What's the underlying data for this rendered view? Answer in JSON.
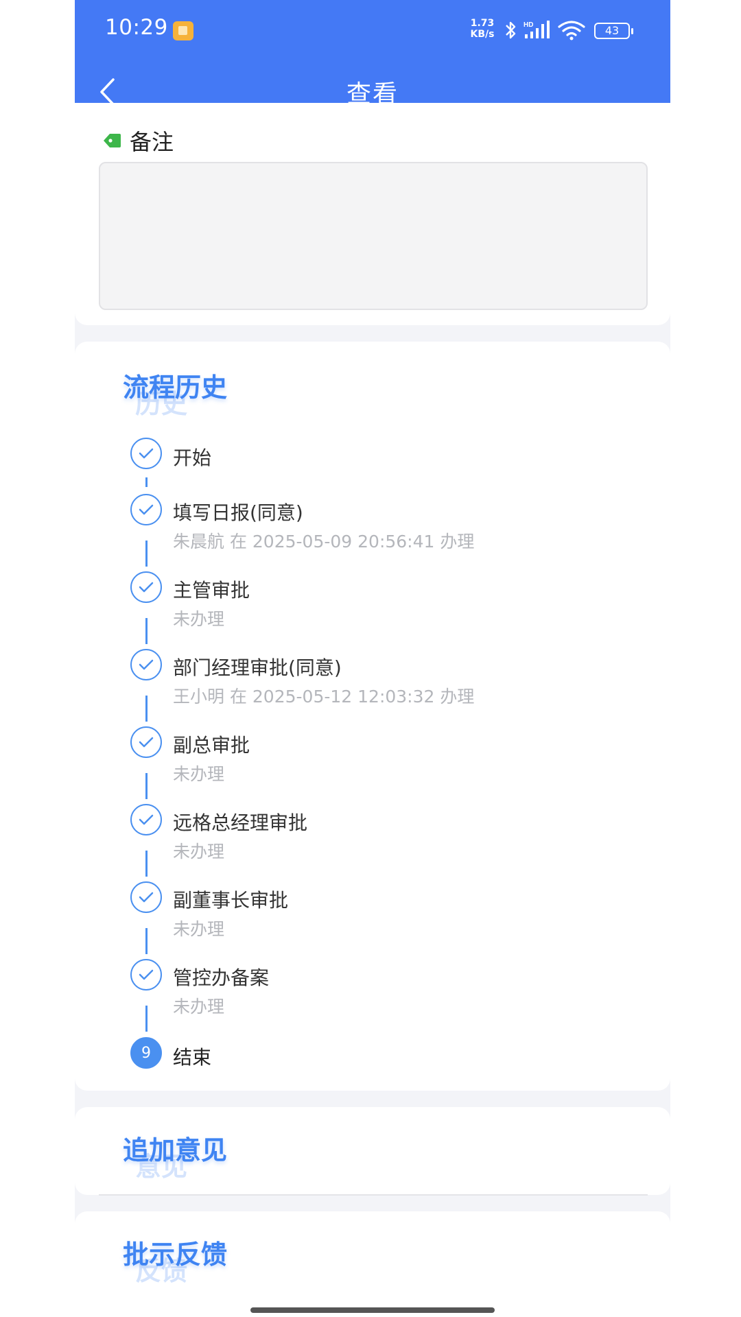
{
  "status_bar": {
    "time": "10:29",
    "net_speed_value": "1.73",
    "net_speed_unit": "KB/s",
    "hd_label": "HD",
    "battery": "43"
  },
  "nav": {
    "title": "查看"
  },
  "remarks": {
    "label": "备注",
    "value": ""
  },
  "history": {
    "title": "流程历史",
    "ghost": "历史",
    "steps": [
      {
        "title": "开始",
        "sub": ""
      },
      {
        "title": "填写日报(同意)",
        "sub": "朱晨航 在 2025-05-09 20:56:41 办理"
      },
      {
        "title": "主管审批",
        "sub": "未办理"
      },
      {
        "title": "部门经理审批(同意)",
        "sub": "王小明 在 2025-05-12 12:03:32 办理"
      },
      {
        "title": "副总审批",
        "sub": "未办理"
      },
      {
        "title": "远格总经理审批",
        "sub": "未办理"
      },
      {
        "title": "副董事长审批",
        "sub": "未办理"
      },
      {
        "title": "管控办备案",
        "sub": "未办理"
      },
      {
        "title": "结束",
        "sub": "",
        "badge": "9"
      }
    ]
  },
  "opinion": {
    "title": "追加意见",
    "ghost": "意见"
  },
  "feedback": {
    "title": "批示反馈",
    "ghost": "反馈"
  },
  "colors": {
    "header": "#4479f5",
    "accent": "#3f84f2",
    "timeline": "#4a90f0",
    "tag": "#3db64a"
  }
}
